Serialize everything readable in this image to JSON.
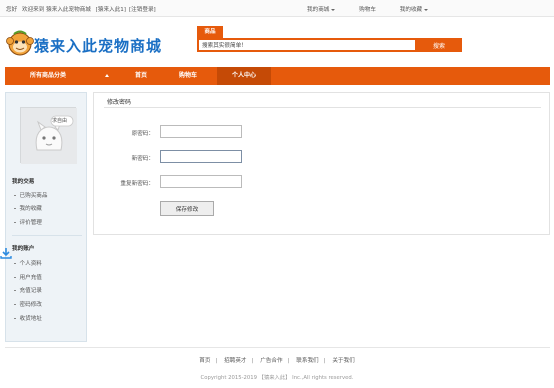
{
  "topbar": {
    "greeting": "您好",
    "welcome": "欢迎来到 猿来入此宠物商城",
    "login_register": "[猿来入此1]",
    "logout": "[注销登录]",
    "my_store": "我的商城",
    "cart": "购物车",
    "my_favorites": "我的收藏"
  },
  "header": {
    "logo_text": "猿来入此宠物商城",
    "search_tab": "商品",
    "search_value": "搜索其实很简单！",
    "search_button": "搜索"
  },
  "nav": {
    "all_categories": "所有商品分类",
    "home": "首页",
    "cart": "购物车",
    "user_center": "个人中心"
  },
  "sidebar": {
    "avatar_badge": "求自由",
    "trade_title": "我的交易",
    "trade_items": [
      "已购买商品",
      "我的收藏",
      "评价管理"
    ],
    "account_title": "我的账户",
    "account_items": [
      "个人资料",
      "用户充值",
      "充值记录",
      "密码修改",
      "收货地址"
    ]
  },
  "main": {
    "title": "修改密码",
    "old_password_label": "原密码：",
    "new_password_label": "新密码：",
    "confirm_password_label": "重复新密码：",
    "save_button": "保存修改"
  },
  "footer": {
    "links": [
      "首页",
      "招聘英才",
      "广告合作",
      "联系我们",
      "关于我们"
    ],
    "copyright": "Copyright 2015-2019 【猿来入此】 Inc.,All rights reserved."
  },
  "colors": {
    "accent": "#e65a0c",
    "nav_active": "#c54a06",
    "logo_blue": "#1a6fc4",
    "sidebar_bg": "#eef3f7"
  }
}
